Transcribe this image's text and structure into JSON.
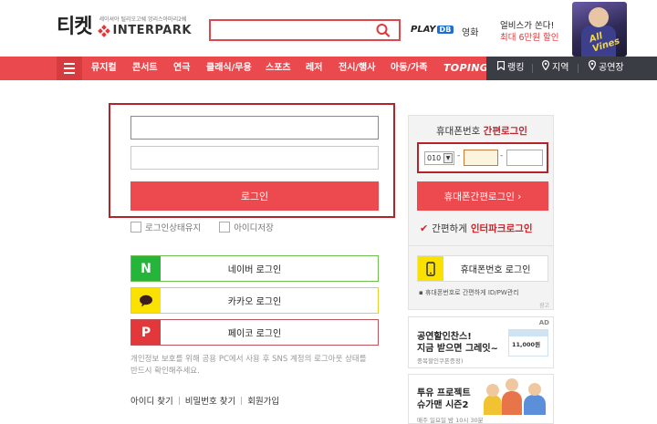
{
  "header": {
    "logo_ticket": "티켓",
    "logo_tagline": "세이셔야 털리오고쉐 엉리스아마리2쉐",
    "logo_brand": "INTERPARK",
    "search_value": "",
    "search_placeholder": "",
    "play_logo": "PLAY",
    "play_logo_badge": "DB",
    "movie_label": "영화",
    "promo_line1": "얼비스가 쏜다!",
    "promo_line2": "최대 6만원 할인",
    "promo_image_text": "All Vines"
  },
  "nav": {
    "items": [
      "뮤지컬",
      "콘서트",
      "연극",
      "클래식/무용",
      "스포츠",
      "레저",
      "전시/행사",
      "아동/가족"
    ],
    "toping": "TOPING",
    "right_items": [
      "랭킹",
      "지역",
      "공연장"
    ]
  },
  "login": {
    "id_value": "",
    "pw_value": "",
    "button_label": "로그인",
    "keep_login_label": "로그인상태유지",
    "save_id_label": "아이디저장",
    "naver_icon": "N",
    "naver_label": "네이버 로그인",
    "kakao_label": "카카오 로그인",
    "payco_icon": "P",
    "payco_label": "페이코 로그인",
    "notice_line1": "개인정보 보호를 위해 공용 PC에서 사용 후 SNS 계정의 로그아웃 상태를",
    "notice_line2": "반드시 확인해주세요.",
    "find_id": "아이디 찾기",
    "find_pw": "비밀번호 찾기",
    "signup": "회원가입"
  },
  "side": {
    "title_prefix": "휴대폰번호 ",
    "title_highlight": "간편로그인",
    "phone_prefix": "010",
    "phone_dash": "-",
    "phone_middle": "",
    "phone_last": "",
    "phone_button": "휴대폰간편로그인 ›",
    "simple_prefix": "간편하게 ",
    "simple_highlight": "인터파크로그인",
    "phone_login_label": "휴대폰번호 로그인",
    "note": "휴대폰번호로 간편하게 ID/PW관리",
    "ad_label": "광고"
  },
  "ads": {
    "ad1_tag": "AD",
    "ad1_line1": "공연할인찬스!",
    "ad1_line2": "지금 받으면 그레잇~",
    "ad1_line3": "중복할인쿠폰증정)",
    "ad1_price": "11,000원",
    "ad2_line1": "투유 프로젝트",
    "ad2_line2": "슈가맨 시즌2",
    "ad2_line3": "매주 일요일 밤 10시 30분"
  },
  "colors": {
    "brand_red": "#ea4a4e",
    "nav_dark": "#3b3d44",
    "border_red": "#b3232a",
    "naver_green": "#26b53b",
    "kakao_yellow": "#fae100"
  },
  "icons": {
    "menu": "hamburger-icon",
    "search": "search-icon",
    "ranking": "bookmark-icon",
    "region": "location-pin-icon",
    "venue": "location-pin-icon",
    "kakao": "speech-bubble-icon",
    "phone": "smartphone-icon",
    "check": "checkmark-icon"
  }
}
